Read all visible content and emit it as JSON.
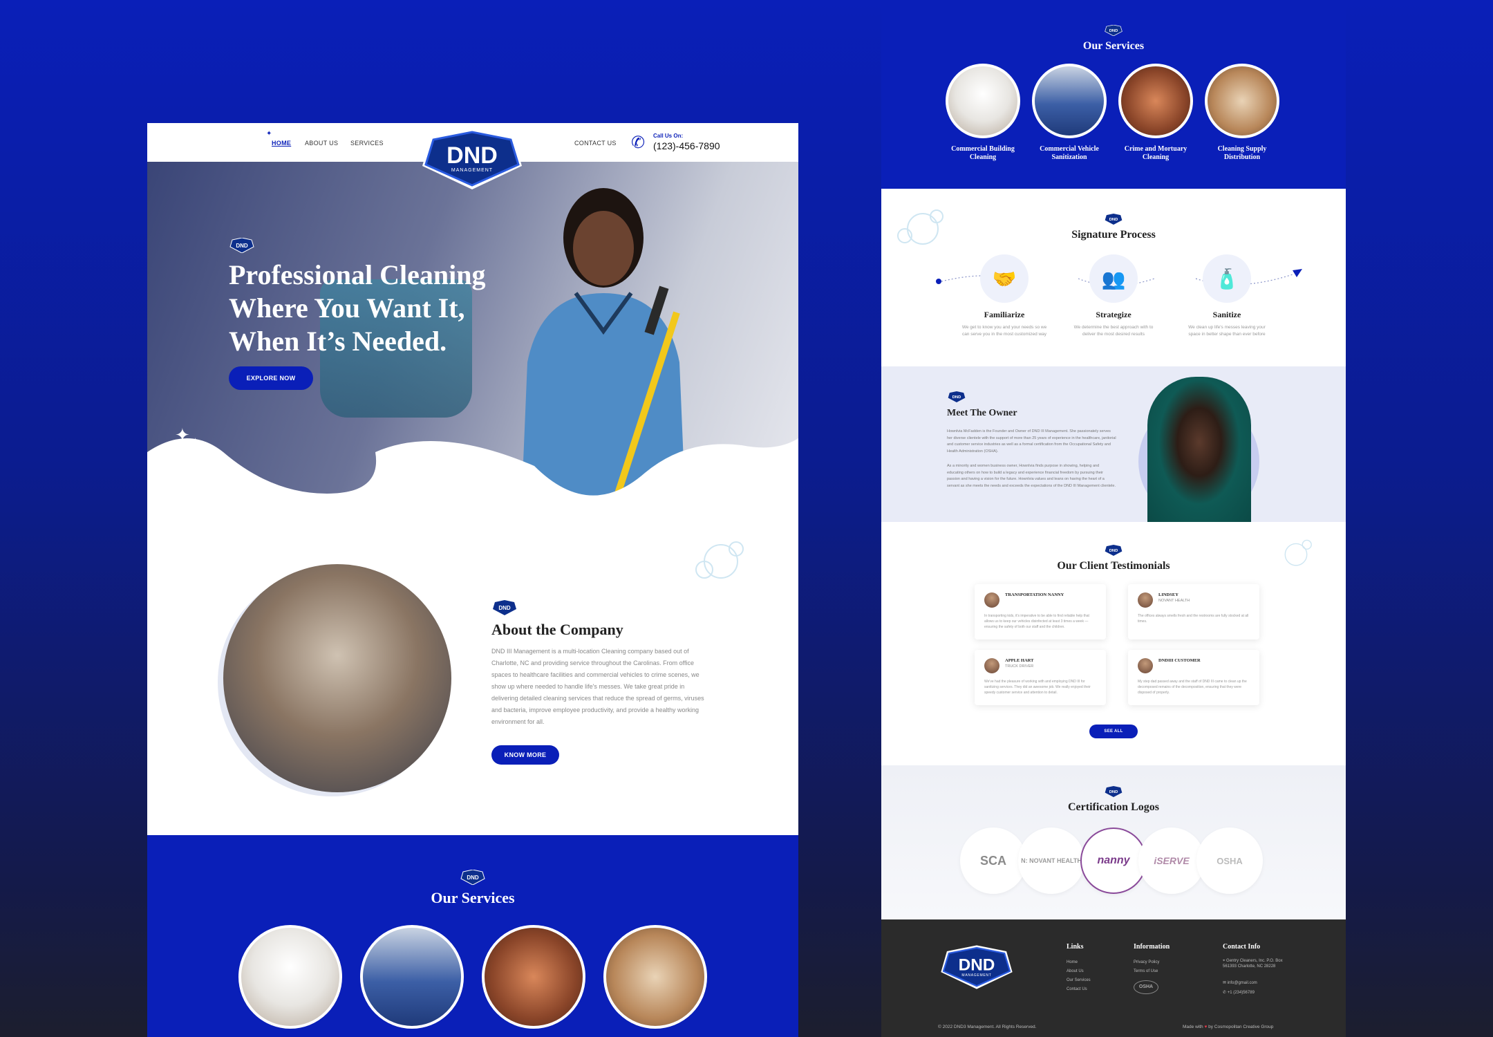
{
  "nav": {
    "home": "HOME",
    "about": "ABOUT US",
    "services": "SERVICES",
    "contact": "CONTACT US",
    "call_label": "Call Us On:",
    "phone": "(123)-456-7890"
  },
  "logo": {
    "name": "DND",
    "sub": "MANAGEMENT"
  },
  "hero": {
    "title_line1": "Professional Cleaning",
    "title_line2": "Where You Want It,",
    "title_line3": "When It’s Needed.",
    "cta": "EXPLORE NOW"
  },
  "about": {
    "title": "About the Company",
    "body": "DND III Management is a multi-location Cleaning company based out of Charlotte, NC and providing service throughout the Carolinas. From office spaces to healthcare facilities and commercial vehicles to crime scenes, we show up where needed to handle life's messes. We take great pride in delivering detailed cleaning services that reduce the spread of germs, viruses and bacteria, improve employee productivity, and provide a healthy working environment for all.",
    "cta": "KNOW MORE"
  },
  "services": {
    "title": "Our Services",
    "items": [
      {
        "label": "Commercial Building Cleaning"
      },
      {
        "label": "Commercial Vehicle Sanitization"
      },
      {
        "label": "Crime and Mortuary Cleaning"
      },
      {
        "label": "Cleaning Supply Distribution"
      }
    ]
  },
  "process": {
    "title": "Signature Process",
    "steps": [
      {
        "title": "Familiarize",
        "desc": "We get to know you and your needs so we can serve you in the most customized way",
        "icon": "handshake-icon"
      },
      {
        "title": "Strategize",
        "desc": "We determine the best approach with to deliver the most desired results",
        "icon": "team-meeting-icon"
      },
      {
        "title": "Sanitize",
        "desc": "We clean up life's messes leaving your space in better shape than ever before",
        "icon": "spray-bottle-icon"
      }
    ]
  },
  "owner": {
    "title": "Meet The Owner",
    "p1": "Hownlvia McFadden is the Founder and Owner of DND III Management. She passionately serves her diverse clientele with the support of more than 25 years of experience in the healthcare, janitorial and customer service industries as well as a formal certification from the Occupational Safety and Health Administration (OSHA).",
    "p2": "As a minority and women business owner, Hownlvia finds purpose in showing, helping and educating others on how to build a legacy and experience financial freedom by pursuing their passion and having a vision for the future. Hownlvia values and leans on having the heart of a servant as she meets the needs and exceeds the expectations of the DND III Management clientele."
  },
  "testimonials": {
    "title": "Our Client Testimonials",
    "cta": "SEE ALL",
    "items": [
      {
        "name": "TRANSPORTATION NANNY",
        "role": "",
        "text": "In transporting kids, it's imperative to be able to find reliable help that allows us to keep our vehicles disinfected at least 3 times a week — ensuring the safety of both our staff and the children."
      },
      {
        "name": "LINDSEY",
        "role": "NOVANT HEALTH",
        "text": "The offices always smells fresh and the restrooms are fully stocked at all times."
      },
      {
        "name": "APPLE HART",
        "role": "TRUCK DRIVER",
        "text": "We've had the pleasure of working with and employing DND III for sanitizing services. They did an awesome job. We really enjoyed their speedy customer service and attention to detail."
      },
      {
        "name": "DNDIII CUSTOMER",
        "role": "",
        "text": "My step dad passed away and the staff of DND III came to clean up the decomposed remains of the decomposition, ensuring that they were disposed of properly."
      }
    ]
  },
  "certs": {
    "title": "Certification Logos",
    "logos": [
      "SCA",
      "N: NOVANT HEALTH",
      "nanny",
      "iSERVE",
      "OSHA"
    ]
  },
  "footer": {
    "links_title": "Links",
    "links": [
      "Home",
      "About Us",
      "Our Services",
      "Contact Us"
    ],
    "info_title": "Information",
    "info": [
      "Privacy Policy",
      "Terms of Use"
    ],
    "contact_title": "Contact Info",
    "address": "Gentry Cleaners, Inc. P.O. Box 561393 Charlotte, NC 28228",
    "email": "info@gmail.com",
    "phone": "+1 (234)56789",
    "copyright": "© 2022 DND3 Management. All Rights Reserved.",
    "made_prefix": "Made with",
    "made_suffix": "by Cosmopolitan Creative Group"
  },
  "colors": {
    "brand": "#0a1fb8",
    "dark": "#2b2b2b",
    "light_bg": "#e8ebf7"
  }
}
